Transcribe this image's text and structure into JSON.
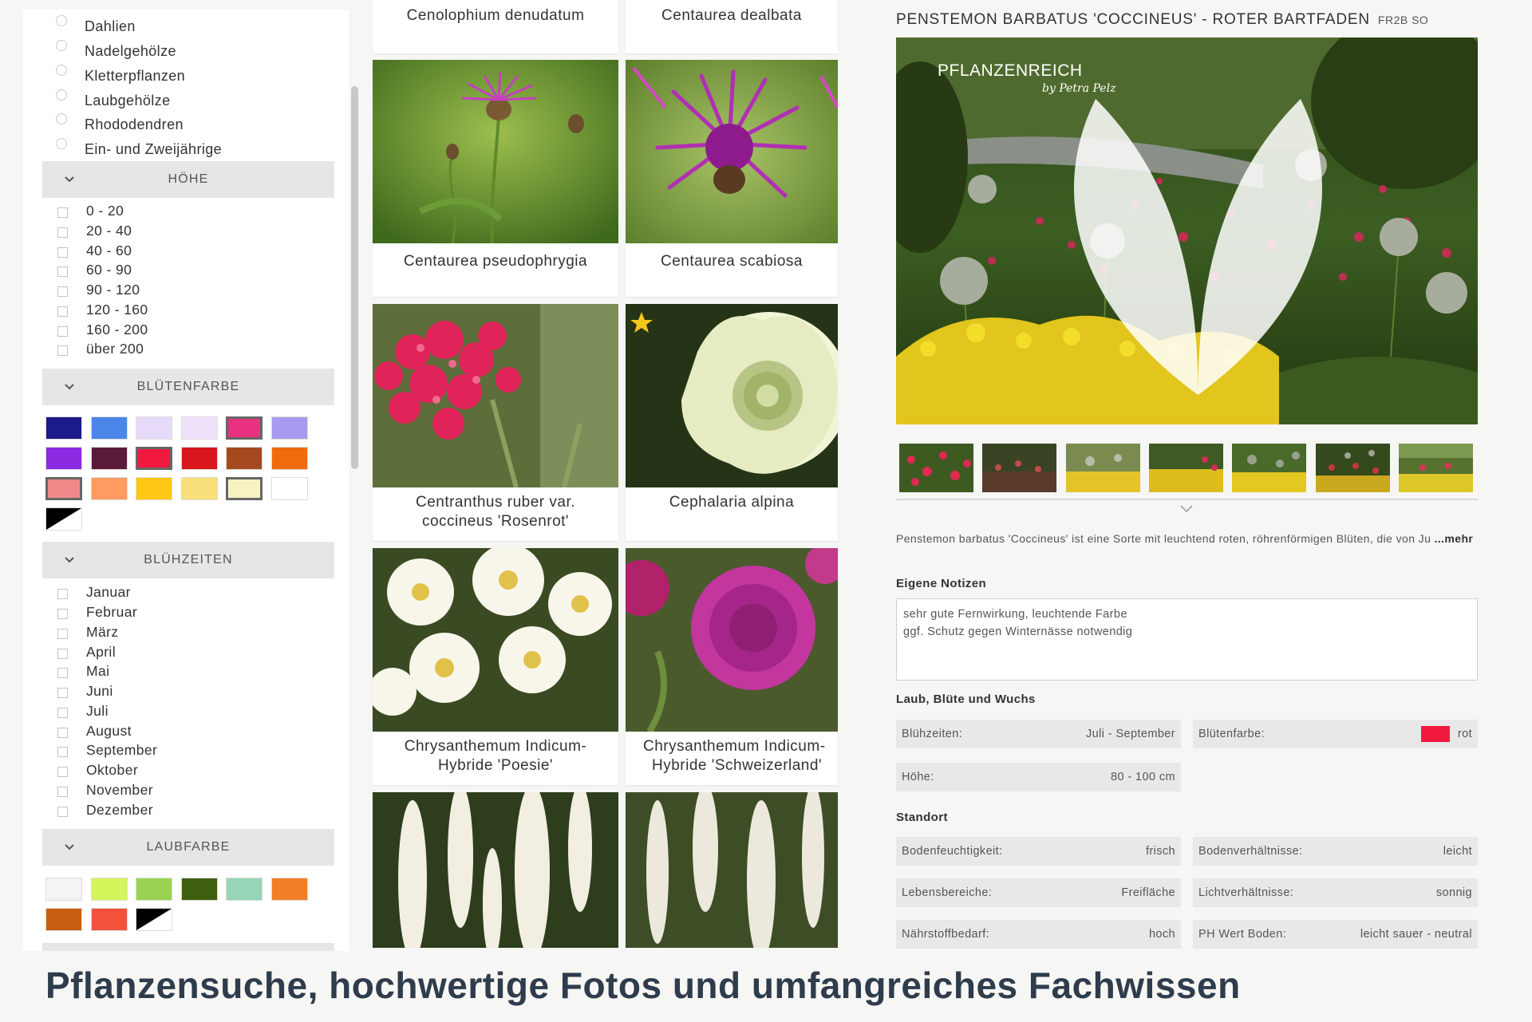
{
  "sidebar": {
    "plant_groups": [
      "Dahlien",
      "Nadelgehölze",
      "Kletterpflanzen",
      "Laubgehölze",
      "Rhododendren",
      "Ein- und Zweijährige"
    ],
    "height_title": "HÖHE",
    "heights": [
      "0 - 20",
      "20 - 40",
      "40 - 60",
      "60 - 90",
      "90 - 120",
      "120 - 160",
      "160 - 200",
      "über 200"
    ],
    "bloom_color_title": "BLÜTENFARBE",
    "bloom_colors": [
      "#1d1b8c",
      "#4a86e8",
      "#e6daf8",
      "#efe2fa",
      "#e8317f",
      "#a89af0",
      "#8a2be2",
      "#5c1a3a",
      "#f2193e",
      "#d9161c",
      "#a54a1f",
      "#f06a0e",
      "#f08a8a",
      "#ff9a60",
      "#ffc814",
      "#fae07a",
      "#f6f2c4",
      "#ffffff"
    ],
    "bloom_color_selected": [
      4,
      8,
      12,
      16
    ],
    "bloom_times_title": "BLÜHZEITEN",
    "months": [
      "Januar",
      "Februar",
      "März",
      "April",
      "Mai",
      "Juni",
      "Juli",
      "August",
      "September",
      "Oktober",
      "November",
      "Dezember"
    ],
    "leaf_color_title": "LAUBFARBE",
    "leaf_colors": [
      "#f4f4f4",
      "#d4f65a",
      "#9ad252",
      "#3f5f10",
      "#96d6b6",
      "#f27e28",
      "#c85e10",
      "#f4503a"
    ]
  },
  "grid": {
    "cards": [
      {
        "name": "Cenolophium denudatum"
      },
      {
        "name": "Centaurea dealbata"
      },
      {
        "name": "Centaurea pseudophrygia"
      },
      {
        "name": "Centaurea scabiosa"
      },
      {
        "name": "Centranthus ruber var. coccineus 'Rosenrot'",
        "line1": "Centranthus ruber var.",
        "line2": "coccineus 'Rosenrot'"
      },
      {
        "name": "Cephalaria alpina"
      },
      {
        "name": "Chrysanthemum Indicum-Hybride 'Poesie'",
        "line1": "Chrysanthemum Indicum-",
        "line2": "Hybride 'Poesie'"
      },
      {
        "name": "Chrysanthemum Indicum-Hybride 'Schweizerland'",
        "line1": "Chrysanthemum Indicum-",
        "line2": "Hybride 'Schweizerland'"
      }
    ]
  },
  "detail": {
    "title": "PENSTEMON BARBATUS 'COCCINEUS' - ROTER BARTFADEN",
    "code": "FR2B SO",
    "logo_text": "PFLANZENREICH",
    "logo_sub": "by Petra Pelz",
    "description": "Penstemon barbatus 'Coccineus' ist eine Sorte mit leuchtend roten, röhrenförmigen Blüten, die von Ju",
    "more_label": "...mehr",
    "notes_title": "Eigene Notizen",
    "notes_line1": "sehr gute Fernwirkung, leuchtende Farbe",
    "notes_line2": "ggf. Schutz gegen Winternässe notwendig",
    "growth_title": "Laub, Blüte und Wuchs",
    "bloom_time_label": "Blühzeiten:",
    "bloom_time_value": "Juli - September",
    "bloom_color_label": "Blütenfarbe:",
    "bloom_color_value": "rot",
    "bloom_color_hex": "#f2193e",
    "height_label": "Höhe:",
    "height_value": "80 - 100 cm",
    "site_title": "Standort",
    "soil_moisture_label": "Bodenfeuchtigkeit:",
    "soil_moisture_value": "frisch",
    "soil_cond_label": "Bodenverhältnisse:",
    "soil_cond_value": "leicht",
    "habitat_label": "Lebensbereiche:",
    "habitat_value": "Freifläche",
    "light_label": "Lichtverhältnisse:",
    "light_value": "sonnig",
    "nutrient_label": "Nährstoffbedarf:",
    "nutrient_value": "hoch",
    "ph_label": "PH Wert Boden:",
    "ph_value": "leicht sauer - neutral"
  },
  "caption": "Pflanzensuche, hochwertige Fotos und umfangreiches Fachwissen"
}
